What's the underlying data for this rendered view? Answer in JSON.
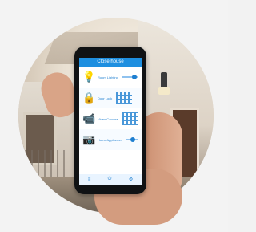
{
  "phone_ui": {
    "title": "Close house",
    "rows": [
      {
        "label": "Room Lighting",
        "icon": "bulb-icon",
        "slider_level": 0.6
      },
      {
        "label": "Door Lock",
        "icon": "lock-icon",
        "slider_level": null
      },
      {
        "label": "Video Camera",
        "icon": "camera-icon",
        "slider_level": null
      },
      {
        "label": "Home Appliances",
        "icon": "camera-icon",
        "slider_level": 0.35
      }
    ]
  }
}
